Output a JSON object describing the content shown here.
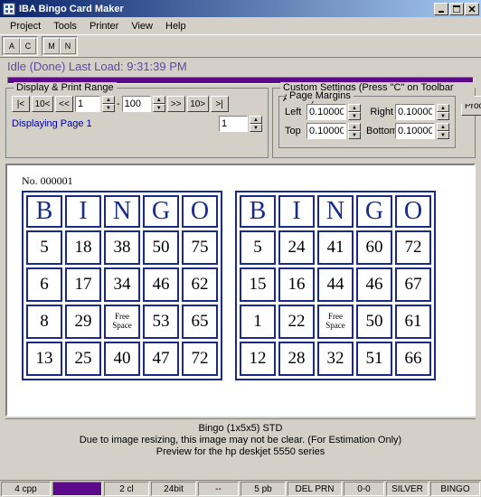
{
  "title": "IBA Bingo Card Maker",
  "menu": [
    "Project",
    "Tools",
    "Printer",
    "View",
    "Help"
  ],
  "toolbar": {
    "g1": [
      "A",
      "C"
    ],
    "g2": [
      "M",
      "N"
    ]
  },
  "status_line": {
    "idle": "Idle (Done) ",
    "last": "Last Load: 9:31:39 PM"
  },
  "display_range": {
    "legend": "Display & Print Range",
    "first": "|<",
    "ten_back": "10<",
    "prev": "<<",
    "from": "1",
    "to": "100",
    "next": ">>",
    "ten_fwd": "10>",
    "last_btn": ">|",
    "displaying": "Displaying Page 1",
    "page_field": "1"
  },
  "custom": {
    "legend": "Custom Settings  (Press \"C\" on Toolbar Above)",
    "margins_legend": "Page Margins",
    "left": "Left",
    "left_v": "0.10000",
    "right": "Right",
    "right_v": "0.10000",
    "top": "Top",
    "top_v": "0.10000",
    "bottom": "Bottom",
    "bottom_v": "0.10000",
    "proof": "Proof"
  },
  "preview": {
    "number": "No. 000001",
    "headers": [
      "B",
      "I",
      "N",
      "G",
      "O"
    ],
    "free": "Free Space",
    "card1": [
      [
        5,
        18,
        38,
        50,
        75
      ],
      [
        6,
        17,
        34,
        46,
        62
      ],
      [
        8,
        29,
        "FREE",
        53,
        65
      ],
      [
        13,
        25,
        40,
        47,
        72
      ]
    ],
    "card2": [
      [
        5,
        24,
        41,
        60,
        72
      ],
      [
        15,
        16,
        44,
        46,
        67
      ],
      [
        1,
        22,
        "FREE",
        50,
        61
      ],
      [
        12,
        28,
        32,
        51,
        66
      ]
    ],
    "footer1": "Bingo (1x5x5) STD",
    "footer2": "Due to image resizing, this image may not be clear.   (For Estimation Only)",
    "footer3": "Preview for the hp deskjet 5550 series"
  },
  "statusbar": [
    "4 cpp",
    "",
    "2 cl",
    "24bit",
    "--",
    "5 pb",
    "DEL PRN",
    "0-0",
    "SILVER",
    "BINGO"
  ]
}
